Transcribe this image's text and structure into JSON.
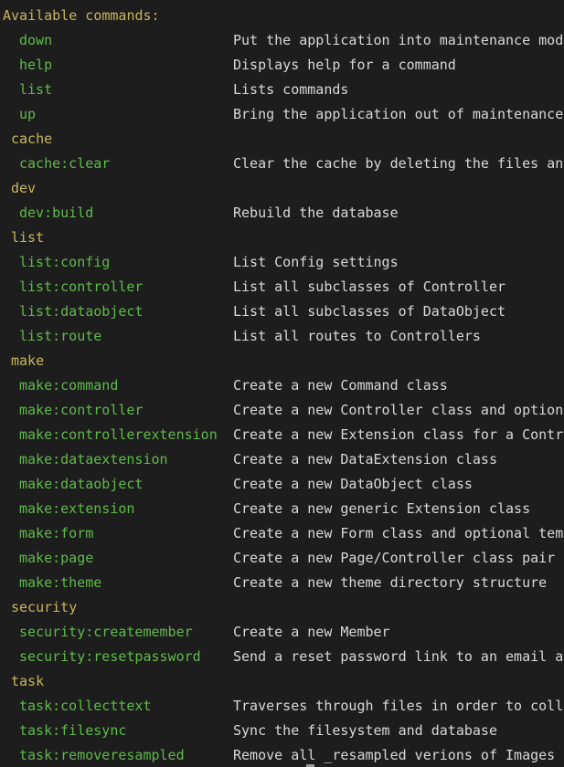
{
  "header": "Available commands:",
  "lines": [
    {
      "type": "cmd",
      "name": "down",
      "desc": "Put the application into maintenance mode"
    },
    {
      "type": "cmd",
      "name": "help",
      "desc": "Displays help for a command"
    },
    {
      "type": "cmd",
      "name": "list",
      "desc": "Lists commands"
    },
    {
      "type": "cmd",
      "name": "up",
      "desc": "Bring the application out of maintenance mode"
    },
    {
      "type": "group",
      "name": "cache"
    },
    {
      "type": "cmd",
      "name": "cache:clear",
      "desc": "Clear the cache by deleting the files and directories"
    },
    {
      "type": "group",
      "name": "dev"
    },
    {
      "type": "cmd",
      "name": "dev:build",
      "desc": "Rebuild the database"
    },
    {
      "type": "group",
      "name": "list"
    },
    {
      "type": "cmd",
      "name": "list:config",
      "desc": "List Config settings"
    },
    {
      "type": "cmd",
      "name": "list:controller",
      "desc": "List all subclasses of Controller"
    },
    {
      "type": "cmd",
      "name": "list:dataobject",
      "desc": "List all subclasses of DataObject"
    },
    {
      "type": "cmd",
      "name": "list:route",
      "desc": "List all routes to Controllers"
    },
    {
      "type": "group",
      "name": "make"
    },
    {
      "type": "cmd",
      "name": "make:command",
      "desc": "Create a new Command class"
    },
    {
      "type": "cmd",
      "name": "make:controller",
      "desc": "Create a new Controller class and optional template"
    },
    {
      "type": "cmd",
      "name": "make:controllerextension",
      "desc": "Create a new Extension class for a Controller"
    },
    {
      "type": "cmd",
      "name": "make:dataextension",
      "desc": "Create a new DataExtension class"
    },
    {
      "type": "cmd",
      "name": "make:dataobject",
      "desc": "Create a new DataObject class"
    },
    {
      "type": "cmd",
      "name": "make:extension",
      "desc": "Create a new generic Extension class"
    },
    {
      "type": "cmd",
      "name": "make:form",
      "desc": "Create a new Form class and optional template"
    },
    {
      "type": "cmd",
      "name": "make:page",
      "desc": "Create a new Page/Controller class pair and templates"
    },
    {
      "type": "cmd",
      "name": "make:theme",
      "desc": "Create a new theme directory structure"
    },
    {
      "type": "group",
      "name": "security"
    },
    {
      "type": "cmd",
      "name": "security:createmember",
      "desc": "Create a new Member"
    },
    {
      "type": "cmd",
      "name": "security:resetpassword",
      "desc": "Send a reset password link to an email address"
    },
    {
      "type": "group",
      "name": "task"
    },
    {
      "type": "cmd",
      "name": "task:collecttext",
      "desc": "Traverses through files in order to collect the entities"
    },
    {
      "type": "cmd",
      "name": "task:filesync",
      "desc": "Sync the filesystem and database"
    },
    {
      "type": "cmd",
      "name": "task:removeresampled",
      "desc": "Remove all _resampled verions of Images"
    }
  ]
}
